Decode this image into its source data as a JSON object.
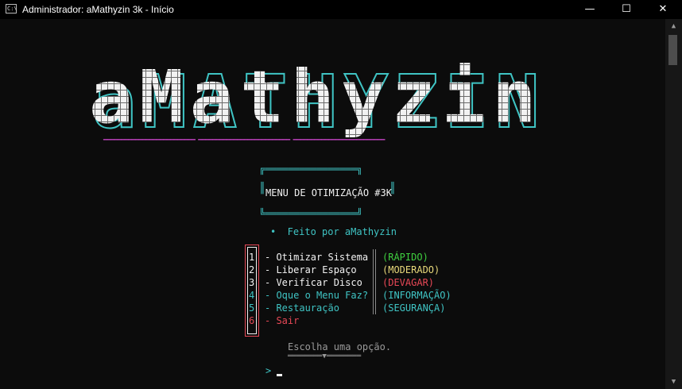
{
  "window": {
    "title": "Administrador:  aMathyzin 3k - Início",
    "icon": "console-icon",
    "controls": {
      "minimize": "—",
      "maximize": "☐",
      "close": "✕"
    }
  },
  "banner": {
    "text": "aMathyzin",
    "underline": "━━━━━━━━━━━━━━━━━━━━━━━━━━ ━━━━━━━━━━━━━━━━━━━━━━━━━━ ━━━━━━━━━━━━━━━━━━━━━━━━━━"
  },
  "menu_box": {
    "top": "╔════════════════╗",
    "title": "MENU DE OTIMIZAÇÃO #3K",
    "bottom": "╚════════════════╝"
  },
  "credit": "•  Feito por aMathyzin",
  "options": [
    {
      "num": "1",
      "label": "- Otimizar Sistema",
      "tag": "(RÁPIDO)"
    },
    {
      "num": "2",
      "label": "- Liberar Espaço",
      "tag": "(MODERADO)"
    },
    {
      "num": "3",
      "label": "- Verificar Disco",
      "tag": "(DEVAGAR)"
    },
    {
      "num": "4",
      "label": "- Oque o Menu Faz?",
      "tag": "(INFORMAÇÃO)"
    },
    {
      "num": "5",
      "label": "- Restauração",
      "tag": "(SEGURANÇA)"
    },
    {
      "num": "6",
      "label": "- Sair",
      "tag": ""
    }
  ],
  "prompt_hint": "Escolha uma opção.",
  "prompt_line": "════════▼════════",
  "prompt_symbol": ">",
  "colors": {
    "cyan": "#3fc4c4",
    "red": "#e74856",
    "green": "#3fcf3f",
    "yellow": "#e8d87a",
    "magenta": "#b43fb4"
  }
}
